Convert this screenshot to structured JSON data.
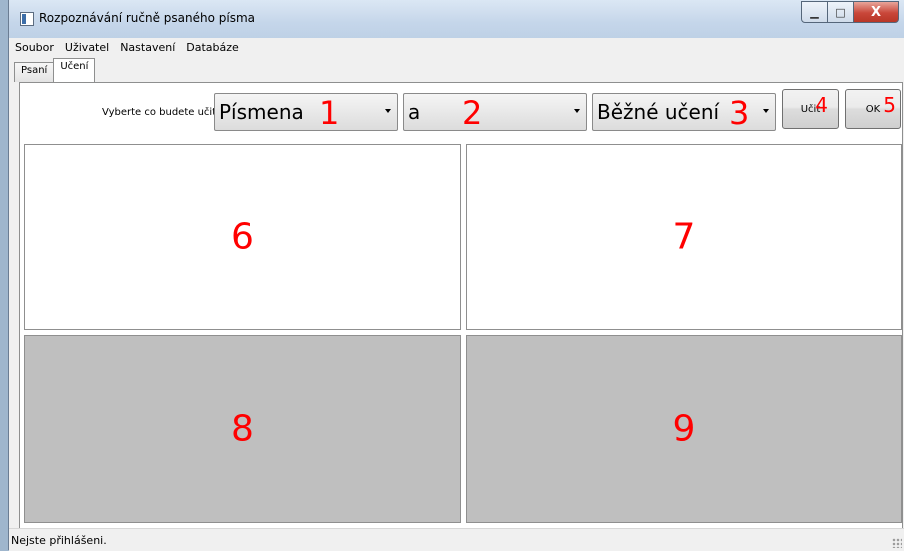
{
  "window": {
    "title": "Rozpoznávání ručně psaného písma",
    "caption_buttons": {
      "minimize": "▁",
      "maximize": "□",
      "close": "X"
    }
  },
  "menubar": {
    "items": [
      "Soubor",
      "Uživatel",
      "Nastavení",
      "Databáze"
    ]
  },
  "tabs": [
    {
      "label": "Psaní",
      "active": false
    },
    {
      "label": "Učení",
      "active": true
    }
  ],
  "toolbar": {
    "prompt": "Vyberte co budete učit:",
    "combo1": {
      "value": "Písmena",
      "marker": "1"
    },
    "combo2": {
      "value": "a",
      "marker": "2"
    },
    "combo3": {
      "value": "Běžné učení",
      "marker": "3"
    },
    "learn_button": {
      "label": "Učit",
      "marker": "4"
    },
    "ok_button": {
      "label": "OK",
      "marker": "5"
    }
  },
  "panels": {
    "p6": "6",
    "p7": "7",
    "p8": "8",
    "p9": "9"
  },
  "status": {
    "text": "Nejste přihlášeni."
  },
  "colors": {
    "marker": "#ff0000",
    "canvas_white": "#ffffff",
    "canvas_gray": "#bfbfbf"
  }
}
